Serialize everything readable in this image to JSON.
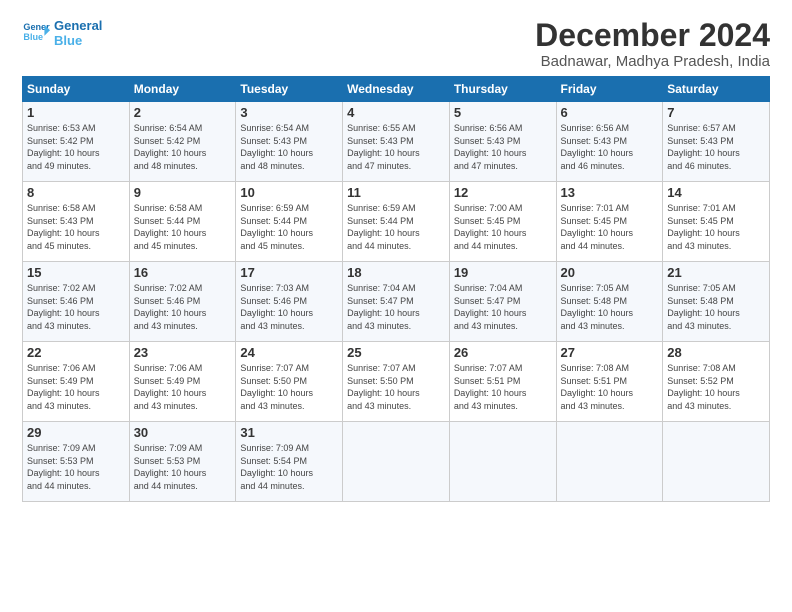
{
  "logo": {
    "line1": "General",
    "line2": "Blue"
  },
  "title": "December 2024",
  "location": "Badnawar, Madhya Pradesh, India",
  "days_of_week": [
    "Sunday",
    "Monday",
    "Tuesday",
    "Wednesday",
    "Thursday",
    "Friday",
    "Saturday"
  ],
  "weeks": [
    [
      {
        "day": "1",
        "sunrise": "6:53 AM",
        "sunset": "5:42 PM",
        "daylight": "10 hours and 49 minutes."
      },
      {
        "day": "2",
        "sunrise": "6:54 AM",
        "sunset": "5:42 PM",
        "daylight": "10 hours and 48 minutes."
      },
      {
        "day": "3",
        "sunrise": "6:54 AM",
        "sunset": "5:43 PM",
        "daylight": "10 hours and 48 minutes."
      },
      {
        "day": "4",
        "sunrise": "6:55 AM",
        "sunset": "5:43 PM",
        "daylight": "10 hours and 47 minutes."
      },
      {
        "day": "5",
        "sunrise": "6:56 AM",
        "sunset": "5:43 PM",
        "daylight": "10 hours and 47 minutes."
      },
      {
        "day": "6",
        "sunrise": "6:56 AM",
        "sunset": "5:43 PM",
        "daylight": "10 hours and 46 minutes."
      },
      {
        "day": "7",
        "sunrise": "6:57 AM",
        "sunset": "5:43 PM",
        "daylight": "10 hours and 46 minutes."
      }
    ],
    [
      {
        "day": "8",
        "sunrise": "6:58 AM",
        "sunset": "5:43 PM",
        "daylight": "10 hours and 45 minutes."
      },
      {
        "day": "9",
        "sunrise": "6:58 AM",
        "sunset": "5:44 PM",
        "daylight": "10 hours and 45 minutes."
      },
      {
        "day": "10",
        "sunrise": "6:59 AM",
        "sunset": "5:44 PM",
        "daylight": "10 hours and 45 minutes."
      },
      {
        "day": "11",
        "sunrise": "6:59 AM",
        "sunset": "5:44 PM",
        "daylight": "10 hours and 44 minutes."
      },
      {
        "day": "12",
        "sunrise": "7:00 AM",
        "sunset": "5:45 PM",
        "daylight": "10 hours and 44 minutes."
      },
      {
        "day": "13",
        "sunrise": "7:01 AM",
        "sunset": "5:45 PM",
        "daylight": "10 hours and 44 minutes."
      },
      {
        "day": "14",
        "sunrise": "7:01 AM",
        "sunset": "5:45 PM",
        "daylight": "10 hours and 43 minutes."
      }
    ],
    [
      {
        "day": "15",
        "sunrise": "7:02 AM",
        "sunset": "5:46 PM",
        "daylight": "10 hours and 43 minutes."
      },
      {
        "day": "16",
        "sunrise": "7:02 AM",
        "sunset": "5:46 PM",
        "daylight": "10 hours and 43 minutes."
      },
      {
        "day": "17",
        "sunrise": "7:03 AM",
        "sunset": "5:46 PM",
        "daylight": "10 hours and 43 minutes."
      },
      {
        "day": "18",
        "sunrise": "7:04 AM",
        "sunset": "5:47 PM",
        "daylight": "10 hours and 43 minutes."
      },
      {
        "day": "19",
        "sunrise": "7:04 AM",
        "sunset": "5:47 PM",
        "daylight": "10 hours and 43 minutes."
      },
      {
        "day": "20",
        "sunrise": "7:05 AM",
        "sunset": "5:48 PM",
        "daylight": "10 hours and 43 minutes."
      },
      {
        "day": "21",
        "sunrise": "7:05 AM",
        "sunset": "5:48 PM",
        "daylight": "10 hours and 43 minutes."
      }
    ],
    [
      {
        "day": "22",
        "sunrise": "7:06 AM",
        "sunset": "5:49 PM",
        "daylight": "10 hours and 43 minutes."
      },
      {
        "day": "23",
        "sunrise": "7:06 AM",
        "sunset": "5:49 PM",
        "daylight": "10 hours and 43 minutes."
      },
      {
        "day": "24",
        "sunrise": "7:07 AM",
        "sunset": "5:50 PM",
        "daylight": "10 hours and 43 minutes."
      },
      {
        "day": "25",
        "sunrise": "7:07 AM",
        "sunset": "5:50 PM",
        "daylight": "10 hours and 43 minutes."
      },
      {
        "day": "26",
        "sunrise": "7:07 AM",
        "sunset": "5:51 PM",
        "daylight": "10 hours and 43 minutes."
      },
      {
        "day": "27",
        "sunrise": "7:08 AM",
        "sunset": "5:51 PM",
        "daylight": "10 hours and 43 minutes."
      },
      {
        "day": "28",
        "sunrise": "7:08 AM",
        "sunset": "5:52 PM",
        "daylight": "10 hours and 43 minutes."
      }
    ],
    [
      {
        "day": "29",
        "sunrise": "7:09 AM",
        "sunset": "5:53 PM",
        "daylight": "10 hours and 44 minutes."
      },
      {
        "day": "30",
        "sunrise": "7:09 AM",
        "sunset": "5:53 PM",
        "daylight": "10 hours and 44 minutes."
      },
      {
        "day": "31",
        "sunrise": "7:09 AM",
        "sunset": "5:54 PM",
        "daylight": "10 hours and 44 minutes."
      },
      null,
      null,
      null,
      null
    ]
  ],
  "labels": {
    "sunrise": "Sunrise:",
    "sunset": "Sunset:",
    "daylight": "Daylight:"
  }
}
